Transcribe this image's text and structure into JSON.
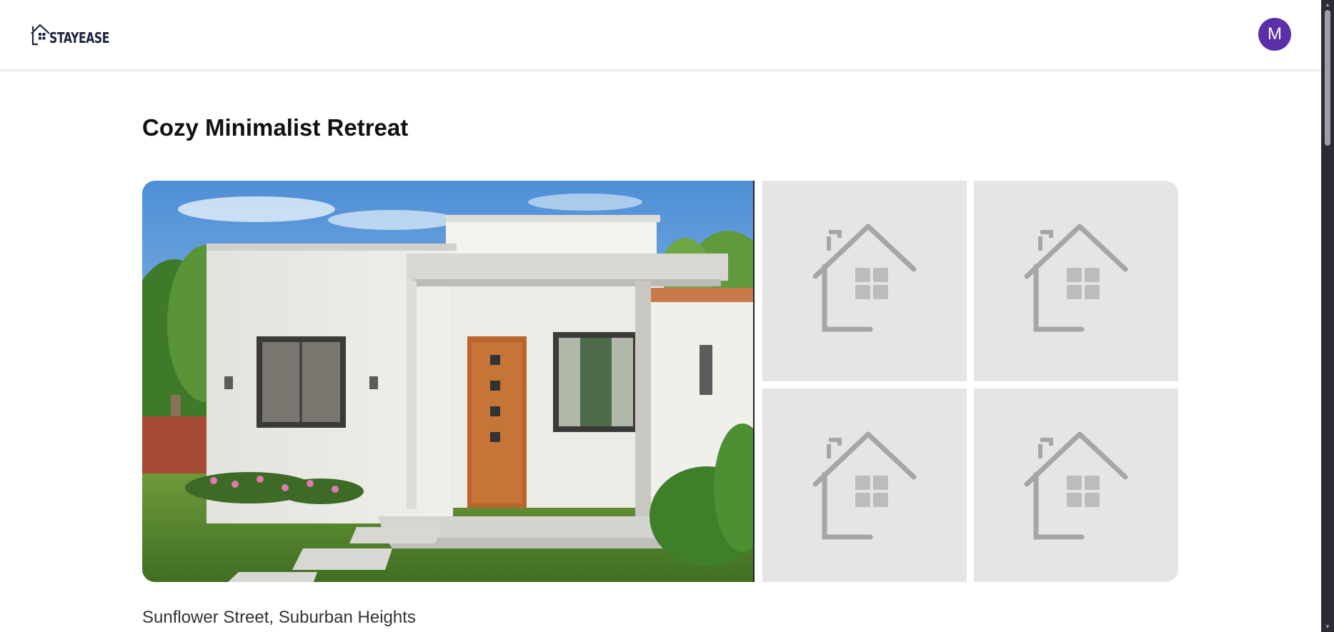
{
  "app": {
    "brand": "STAYEASE",
    "user_initial": "M"
  },
  "listing": {
    "title": "Cozy Minimalist Retreat",
    "address": "Sunflower Street, Suburban Heights",
    "photos": [
      {
        "icon": "house-photo",
        "kind": "main"
      },
      {
        "icon": "house-placeholder-icon",
        "kind": "placeholder"
      },
      {
        "icon": "house-placeholder-icon",
        "kind": "placeholder"
      },
      {
        "icon": "house-placeholder-icon",
        "kind": "placeholder"
      },
      {
        "icon": "house-placeholder-icon",
        "kind": "placeholder"
      }
    ]
  },
  "colors": {
    "brand_navy": "#1a2340",
    "avatar_bg": "#5a2fa8",
    "placeholder_bg": "#e5e5e5",
    "placeholder_icon": "#a6a6a6"
  }
}
